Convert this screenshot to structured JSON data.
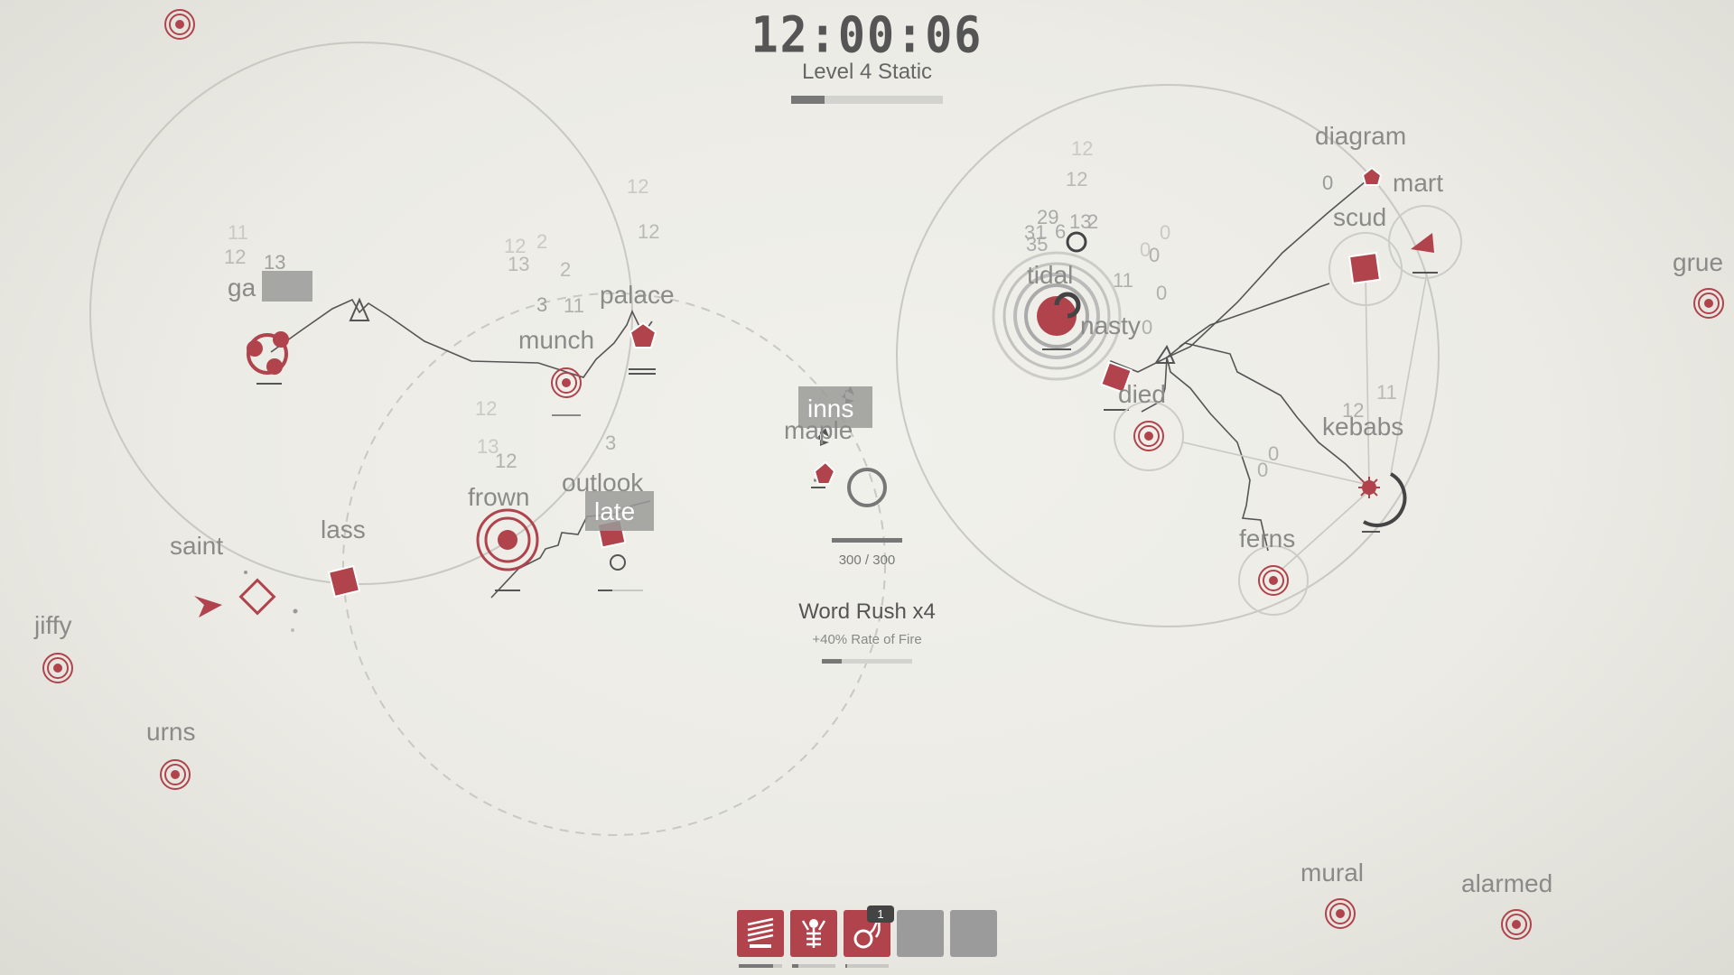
{
  "hud": {
    "timer": "12:00:06",
    "level": "Level 4 Static",
    "level_progress": 0.22
  },
  "player": {
    "hp_text": "300 / 300",
    "hp_fraction": 1.0
  },
  "boost": {
    "title": "Word Rush x4",
    "subtitle": "+40% Rate of Fire",
    "progress": 0.22
  },
  "words": {
    "ga": "ga",
    "munch": "munch",
    "palace": "palace",
    "saint": "saint",
    "lass": "lass",
    "frown": "frown",
    "outlook": "outlook",
    "late": "late",
    "inns": "inns",
    "maple": "maple",
    "jiffy": "jiffy",
    "urns": "urns",
    "diagram": "diagram",
    "mart": "mart",
    "scud": "scud",
    "tidal": "tidal",
    "nasty": "nasty",
    "died": "died",
    "kebabs": "kebabs",
    "ferns": "ferns",
    "grue": "grue",
    "mural": "mural",
    "alarmed": "alarmed"
  },
  "floating_numbers": {
    "n1": "11",
    "n2": "12",
    "n3": "13",
    "n4": "12",
    "n5": "2",
    "n6": "13",
    "n7": "2",
    "n8": "3",
    "n9": "11",
    "n10": "12",
    "n11": "12",
    "n12": "12",
    "n13": "13",
    "n14": "12",
    "n15": "3",
    "n16": "12",
    "n17": "12",
    "n18": "29",
    "n19": "13",
    "n20": "2",
    "n21": "31",
    "n22": "6",
    "n23": "35",
    "n24": "0",
    "n25": "0",
    "n26": "0",
    "n27": "11",
    "n28": "0",
    "n29": "0",
    "n30": "0",
    "n31": "12",
    "n32": "11",
    "n33": "0",
    "n34": "0"
  },
  "abilities": [
    {
      "icon": "lightning-wall-icon",
      "progress": 0.8,
      "badge": ""
    },
    {
      "icon": "figure-beam-icon",
      "progress": 0.15,
      "badge": ""
    },
    {
      "icon": "flame-bomb-icon",
      "progress": 0.05,
      "badge": "1"
    },
    {
      "icon": "empty-slot",
      "progress": 0,
      "badge": ""
    },
    {
      "icon": "empty-slot",
      "progress": 0,
      "badge": ""
    }
  ],
  "colors": {
    "enemy": "#b0434c",
    "line": "#555555",
    "text": "#7a7a7a"
  }
}
